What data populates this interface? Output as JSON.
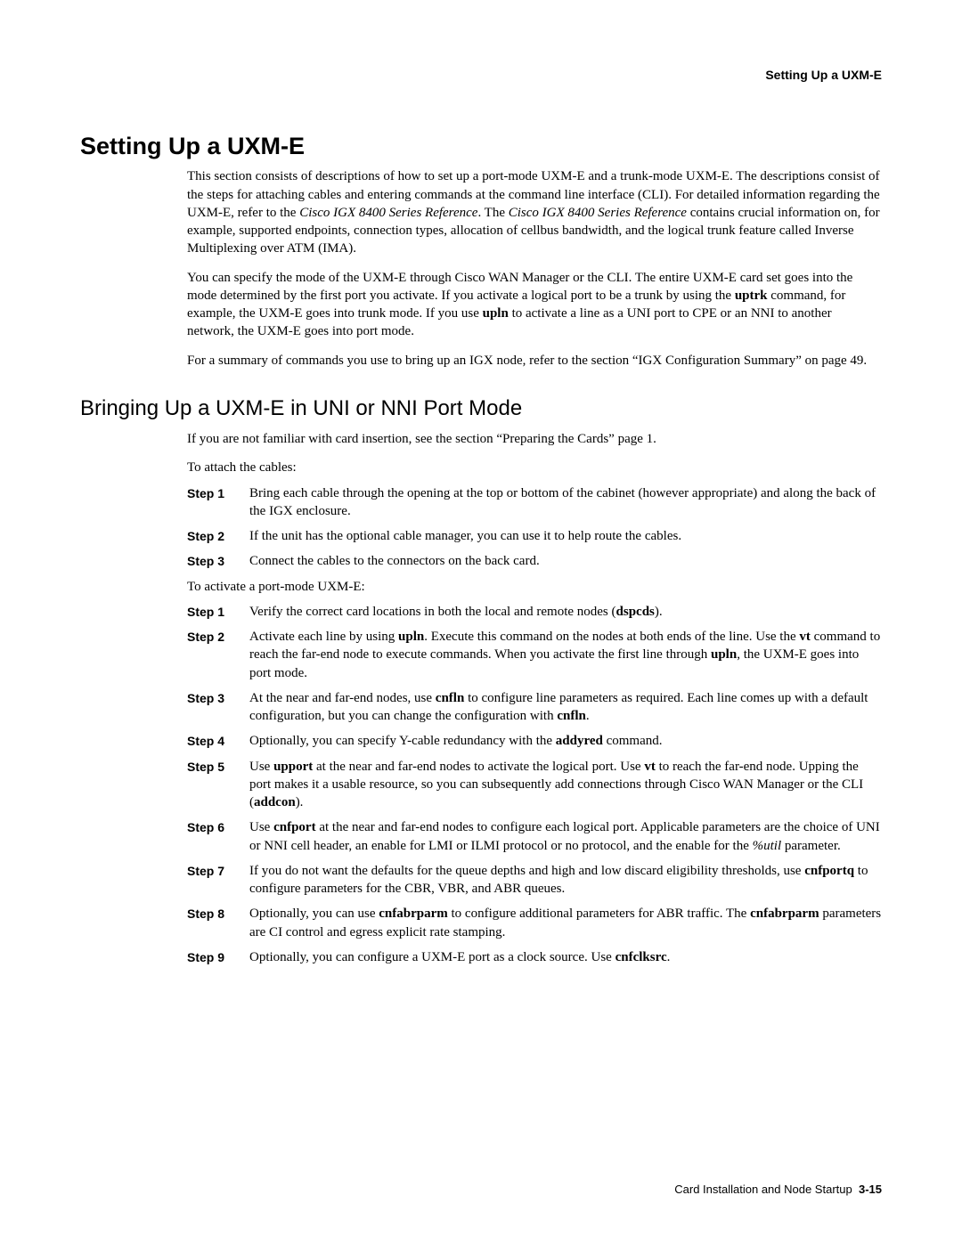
{
  "running_head": "Setting Up a UXM-E",
  "h1": "Setting Up a UXM-E",
  "intro": {
    "p1_a": "This section consists of descriptions of how to set up a port-mode UXM-E and a trunk-mode UXM-E. The descriptions consist of the steps for attaching cables and entering commands at the command line interface (CLI). For detailed information regarding the UXM-E, refer to the ",
    "p1_ref1": "Cisco IGX 8400 Series Reference",
    "p1_b": ". The ",
    "p1_ref2": "Cisco IGX 8400 Series Reference",
    "p1_c": " contains crucial information on, for example, supported endpoints, connection types, allocation of cellbus bandwidth, and the logical trunk feature called Inverse Multiplexing over ATM (IMA).",
    "p2_a": "You can specify the mode of the UXM-E through Cisco WAN Manager or the CLI. The entire UXM-E card set goes into the mode determined by the first port you activate. If you activate a logical port to be a trunk by using the ",
    "p2_cmd1": "uptrk",
    "p2_b": " command, for example, the UXM-E goes into trunk mode. If you use ",
    "p2_cmd2": "upln",
    "p2_c": " to activate a line as a UNI port to CPE or an NNI to another network, the UXM-E goes into port mode.",
    "p3": "For a summary of commands you use to bring up an IGX node, refer to the section “IGX Configuration Summary” on page 49."
  },
  "h2": "Bringing Up a UXM-E in UNI or NNI Port Mode",
  "sub_intro": "If you are not familiar with card insertion, see the section “Preparing the Cards” page 1.",
  "lead1": "To attach the cables:",
  "cable_steps": [
    {
      "label": "Step 1",
      "text_a": "Bring each cable through the opening at the top or bottom of the cabinet (however appropriate) and along the back of the IGX enclosure."
    },
    {
      "label": "Step 2",
      "text_a": "If the unit has the optional cable manager, you can use it to help route the cables."
    },
    {
      "label": "Step 3",
      "text_a": "Connect the cables to the connectors on the back card."
    }
  ],
  "lead2": "To activate a port-mode UXM-E:",
  "activate_steps": {
    "s1": {
      "label": "Step 1",
      "a": "Verify the correct card locations in both the local and remote nodes (",
      "cmd": "dspcds",
      "b": ")."
    },
    "s2": {
      "label": "Step 2",
      "a": "Activate each line by using ",
      "cmd1": "upln",
      "b": ". Execute this command on the nodes at both ends of the line. Use the ",
      "cmd2": "vt",
      "c": " command to reach the far-end node to execute commands. When you activate the first line through ",
      "cmd3": "upln",
      "d": ", the UXM-E goes into port mode."
    },
    "s3": {
      "label": "Step 3",
      "a": "At the near and far-end nodes, use ",
      "cmd1": "cnfln",
      "b": " to configure line parameters as required. Each line comes up with a default configuration, but you can change the configuration with ",
      "cmd2": "cnfln",
      "c": "."
    },
    "s4": {
      "label": "Step 4",
      "a": "Optionally, you can specify Y-cable redundancy with the ",
      "cmd": "addyred",
      "b": " command."
    },
    "s5": {
      "label": "Step 5",
      "a": "Use ",
      "cmd1": "upport",
      "b": " at the near and far-end nodes to activate the logical port. Use ",
      "cmd2": "vt",
      "c": " to reach the far-end node. Upping the port makes it a usable resource, so you can subsequently add connections through Cisco WAN Manager or the CLI (",
      "cmd3": "addcon",
      "d": ")."
    },
    "s6": {
      "label": "Step 6",
      "a": "Use ",
      "cmd": "cnfport",
      "b": " at the near and far-end nodes to configure each logical port. Applicable parameters are the choice of UNI or NNI cell header, an enable for LMI or ILMI protocol or no protocol, and the enable for the ",
      "ital": "%util",
      "c": " parameter."
    },
    "s7": {
      "label": "Step 7",
      "a": "If you do not want the defaults for the queue depths and high and low discard eligibility thresholds, use ",
      "cmd": "cnfportq",
      "b": " to configure parameters for the CBR, VBR, and ABR queues."
    },
    "s8": {
      "label": "Step 8",
      "a": "Optionally, you can use ",
      "cmd1": "cnfabrparm",
      "b": " to configure additional parameters for ABR traffic. The ",
      "cmd2": "cnfabrparm",
      "c": " parameters are CI control and egress explicit rate stamping."
    },
    "s9": {
      "label": "Step 9",
      "a": "Optionally, you can configure a UXM-E port as a clock source. Use ",
      "cmd": "cnfclksrc",
      "b": "."
    }
  },
  "footer": {
    "title": "Card Installation and Node Startup",
    "page": "3-15"
  }
}
